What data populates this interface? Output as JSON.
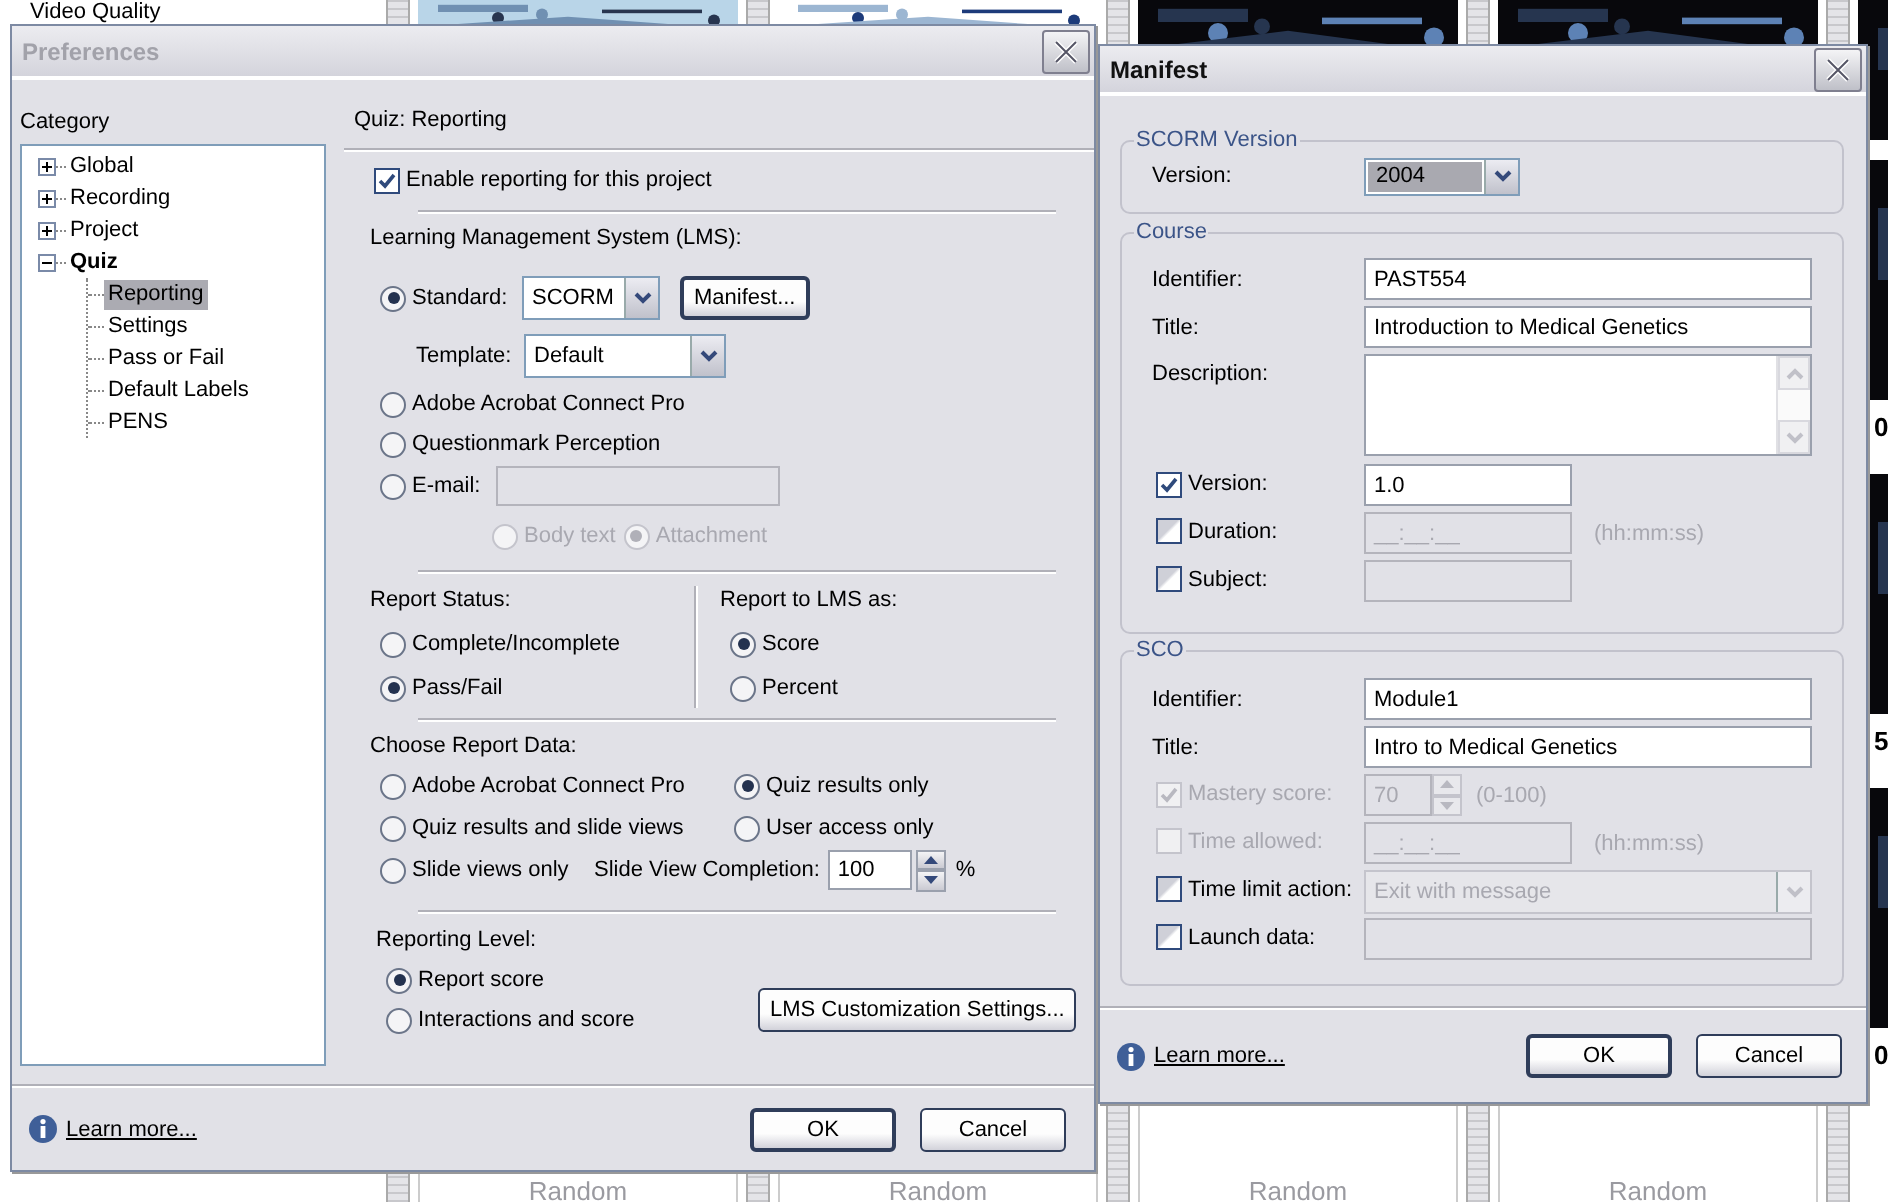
{
  "background": {
    "list_item": "Video Quality",
    "slide_numbers": [
      "0",
      "5",
      "0"
    ],
    "empty_slide_labels": [
      "Random",
      "Random",
      "Random",
      "Random"
    ]
  },
  "preferences": {
    "title": "Preferences",
    "active": false,
    "category_label": "Category",
    "tree": [
      {
        "label": "Global",
        "expanded": false,
        "selected": false
      },
      {
        "label": "Recording",
        "expanded": false,
        "selected": false
      },
      {
        "label": "Project",
        "expanded": false,
        "selected": false
      },
      {
        "label": "Quiz",
        "expanded": true,
        "selected": false,
        "children": [
          {
            "label": "Reporting",
            "selected": true
          },
          {
            "label": "Settings",
            "selected": false
          },
          {
            "label": "Pass or Fail",
            "selected": false
          },
          {
            "label": "Default Labels",
            "selected": false
          },
          {
            "label": "PENS",
            "selected": false
          }
        ]
      }
    ],
    "panel_title": "Quiz: Reporting",
    "enable_reporting": {
      "label": "Enable reporting for this project",
      "checked": true
    },
    "lms": {
      "label": "Learning Management System (LMS):",
      "standard": {
        "label": "Standard:",
        "selected": true,
        "value": "SCORM",
        "button": "Manifest..."
      },
      "template": {
        "label": "Template:",
        "value": "Default"
      },
      "others": [
        {
          "label": "Adobe Acrobat Connect Pro",
          "selected": false
        },
        {
          "label": "Questionmark Perception",
          "selected": false
        }
      ],
      "email": {
        "label": "E-mail:",
        "selected": false
      },
      "email_format": [
        {
          "label": "Body text",
          "selected": false,
          "disabled": true
        },
        {
          "label": "Attachment",
          "selected": true,
          "disabled": true
        }
      ]
    },
    "report_status": {
      "label": "Report Status:",
      "options": [
        {
          "label": "Complete/Incomplete",
          "selected": false
        },
        {
          "label": "Pass/Fail",
          "selected": true
        }
      ]
    },
    "report_as": {
      "label": "Report to LMS as:",
      "options": [
        {
          "label": "Score",
          "selected": true
        },
        {
          "label": "Percent",
          "selected": false
        }
      ]
    },
    "report_data": {
      "label": "Choose Report Data:",
      "options": [
        {
          "label": "Adobe Acrobat Connect Pro",
          "selected": false
        },
        {
          "label": "Quiz results only",
          "selected": true
        },
        {
          "label": "Quiz results and slide views",
          "selected": false
        },
        {
          "label": "User access only",
          "selected": false
        },
        {
          "label": "Slide views only",
          "selected": false
        }
      ],
      "completion_label": "Slide View Completion:",
      "completion_value": "100",
      "completion_unit": "%"
    },
    "reporting_level": {
      "label": "Reporting Level:",
      "options": [
        {
          "label": "Report score",
          "selected": true
        },
        {
          "label": "Interactions and score",
          "selected": false
        }
      ],
      "button": "LMS Customization Settings..."
    },
    "learn_more": "Learn more...",
    "buttons": [
      "OK",
      "Cancel"
    ]
  },
  "manifest": {
    "title": "Manifest",
    "active": true,
    "scorm": {
      "legend": "SCORM Version",
      "label": "Version:",
      "value": "2004"
    },
    "course": {
      "legend": "Course",
      "rows": [
        {
          "kind": "text",
          "label": "Identifier:",
          "value": "PAST554"
        },
        {
          "kind": "text",
          "label": "Title:",
          "value": "Introduction to Medical Genetics"
        },
        {
          "kind": "textarea",
          "label": "Description:"
        },
        {
          "kind": "check_short",
          "label": "Version:",
          "checked": true,
          "disabled": false,
          "value": "1.0"
        },
        {
          "kind": "check_short",
          "label": "Duration:",
          "checked": false,
          "disabled": false,
          "value": "__:__:__",
          "hint": "(hh:mm:ss)"
        },
        {
          "kind": "check_short",
          "label": "Subject:",
          "checked": false,
          "disabled": false
        }
      ]
    },
    "sco": {
      "legend": "SCO",
      "rows": [
        {
          "kind": "text",
          "label": "Identifier:",
          "value": "Module1"
        },
        {
          "kind": "text",
          "label": "Title:",
          "value": "Intro to Medical Genetics"
        },
        {
          "kind": "check_spin",
          "label": "Mastery score:",
          "checked": true,
          "disabled": true,
          "value": "70",
          "hint": "(0-100)"
        },
        {
          "kind": "check_short",
          "label": "Time allowed:",
          "checked": false,
          "disabled": true,
          "value": "__:__:__",
          "hint": "(hh:mm:ss)"
        },
        {
          "kind": "check_select",
          "label": "Time limit action:",
          "checked": false,
          "disabled": false,
          "value": "Exit with message"
        },
        {
          "kind": "check_wide",
          "label": "Launch data:",
          "checked": false,
          "disabled": false
        }
      ]
    },
    "learn_more": "Learn more...",
    "buttons": [
      "OK",
      "Cancel"
    ]
  }
}
